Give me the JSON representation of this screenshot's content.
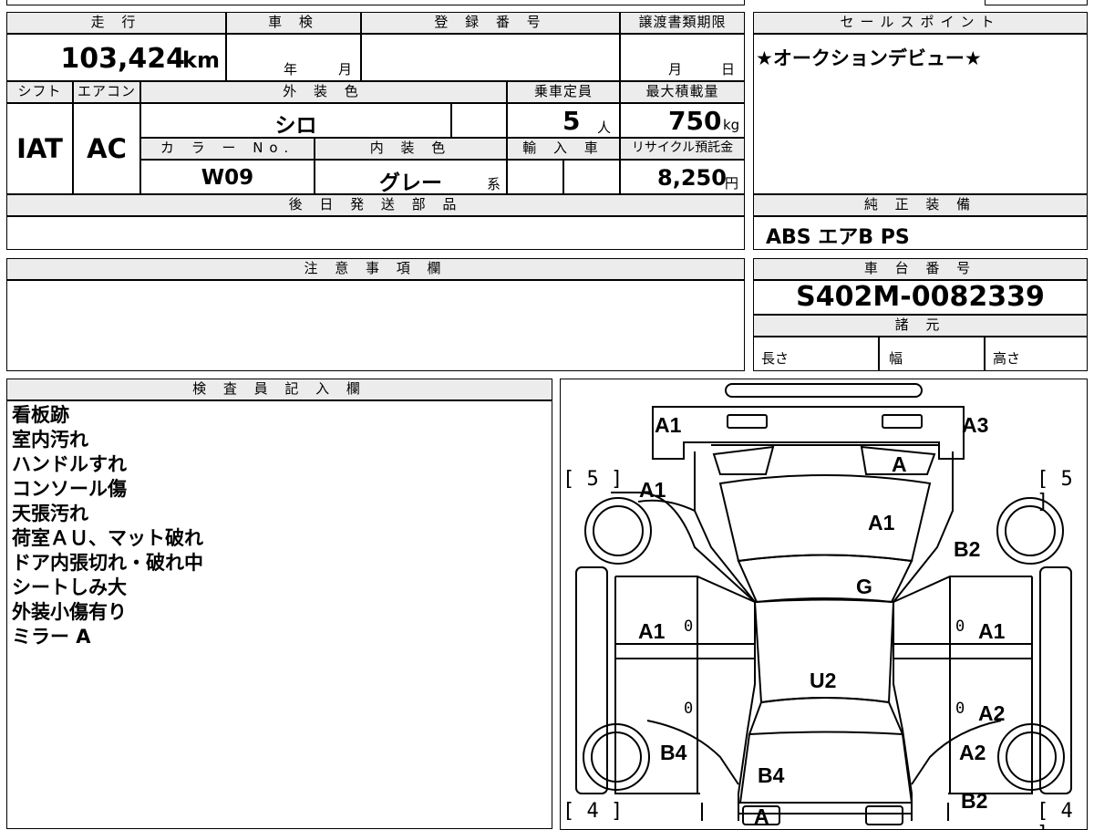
{
  "mileage": {
    "header": "走 行",
    "value": "103,424",
    "unit": "km"
  },
  "shaken": {
    "header": "車 検",
    "year_unit": "年",
    "month_unit": "月"
  },
  "registration": {
    "header": "登 録 番 号"
  },
  "transfer_deadline": {
    "header": "譲渡書類期限",
    "month_unit": "月",
    "day_unit": "日"
  },
  "sales_point": {
    "header": "セールスポイント",
    "text": "★オークションデビュー★"
  },
  "shift": {
    "header": "シフト",
    "value": "IAT"
  },
  "aircon": {
    "header": "エアコン",
    "value": "AC"
  },
  "exterior_color": {
    "header": "外 装 色",
    "value": "シロ"
  },
  "capacity": {
    "header": "乗車定員",
    "value": "5",
    "unit": "人"
  },
  "max_load": {
    "header": "最大積載量",
    "value": "750",
    "unit": "kg"
  },
  "color_no": {
    "header": "カ ラ ー No.",
    "value": "W09"
  },
  "interior_color": {
    "header": "内 装 色",
    "value": "グレー",
    "suffix": "系"
  },
  "import": {
    "header": "輸 入 車"
  },
  "recycle": {
    "header": "リサイクル預託金",
    "value": "8,250",
    "unit": "円"
  },
  "later_parts": {
    "header": "後 日 発 送 部 品"
  },
  "standard_equipment": {
    "header": "純 正 装 備",
    "value": "ABS エアB PS"
  },
  "notes_field": {
    "header": "注 意 事 項 欄"
  },
  "chassis_no": {
    "header": "車 台 番 号",
    "value": "S402M-0082339"
  },
  "specs": {
    "header": "諸 元",
    "length": "長さ",
    "width": "幅",
    "height": "高さ"
  },
  "inspector": {
    "header": "検 査 員 記 入 欄",
    "notes": [
      "看板跡",
      "室内汚れ",
      "ハンドルすれ",
      "コンソール傷",
      "天張汚れ",
      "荷室ＡＵ、マット破れ",
      "ドア内張切れ・破れ中",
      "シートしみ大",
      "外装小傷有り",
      "ミラー A"
    ]
  },
  "diagram": {
    "labels": {
      "front_left": "A1",
      "front_right": "A3",
      "windshield_right": "A",
      "left_fender": "A1",
      "hood": "A1",
      "right_fender": "B2",
      "roof_front": "G",
      "left_front_door": "A1",
      "right_front_door": "A1",
      "roof": "U2",
      "right_rear_door": "A2",
      "left_rear": "B4",
      "cargo": "B4",
      "right_quarter": "A2",
      "rear_right": "B2",
      "rear_bottom": "A"
    },
    "tire_front_left": "[ 5 ]",
    "tire_front_right": "[ 5 ]",
    "tire_rear_left": "[ 4 ]",
    "tire_rear_right": "[ 4 ]",
    "zero_marks": [
      "0",
      "0",
      "0",
      "0"
    ]
  }
}
